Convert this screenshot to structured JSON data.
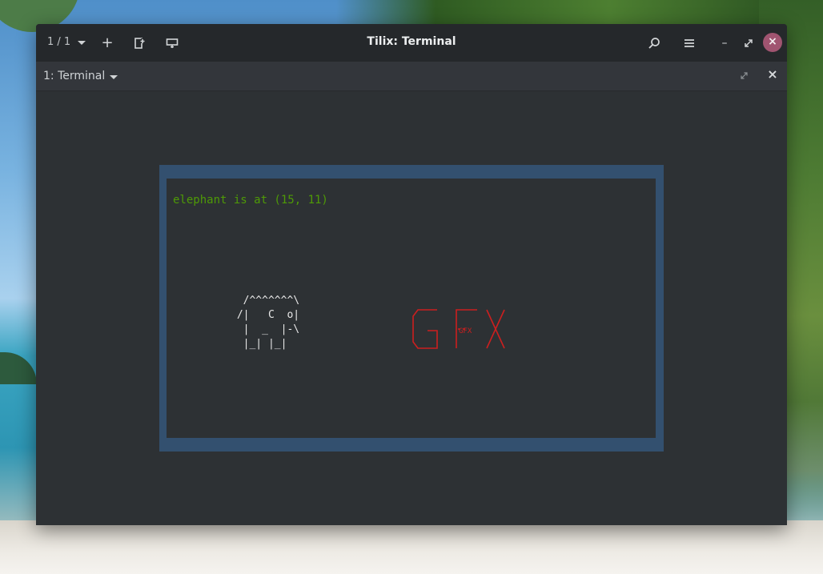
{
  "window": {
    "title": "Tilix: Terminal",
    "session_counter": "1 / 1"
  },
  "header_buttons": {
    "add": "+",
    "new_session": "add-session",
    "sync_input": "sync-input",
    "search": "search",
    "menu": "menu",
    "minimize": "–",
    "maximize": "⤢",
    "close": "×"
  },
  "terminal": {
    "tab_label": "1: Terminal",
    "status_text": "elephant is at (15, 11)",
    "elephant_ascii": "  /^^^^^^^\\\n /|   C  o|\n  |  _  |-\\\n  |_| |_|",
    "gfx_logo_text": "GFX"
  },
  "colors": {
    "status_green": "#4e9a06",
    "frame_blue": "#33506f",
    "logo_red": "#cc1f1f",
    "close_button": "#a05470"
  }
}
